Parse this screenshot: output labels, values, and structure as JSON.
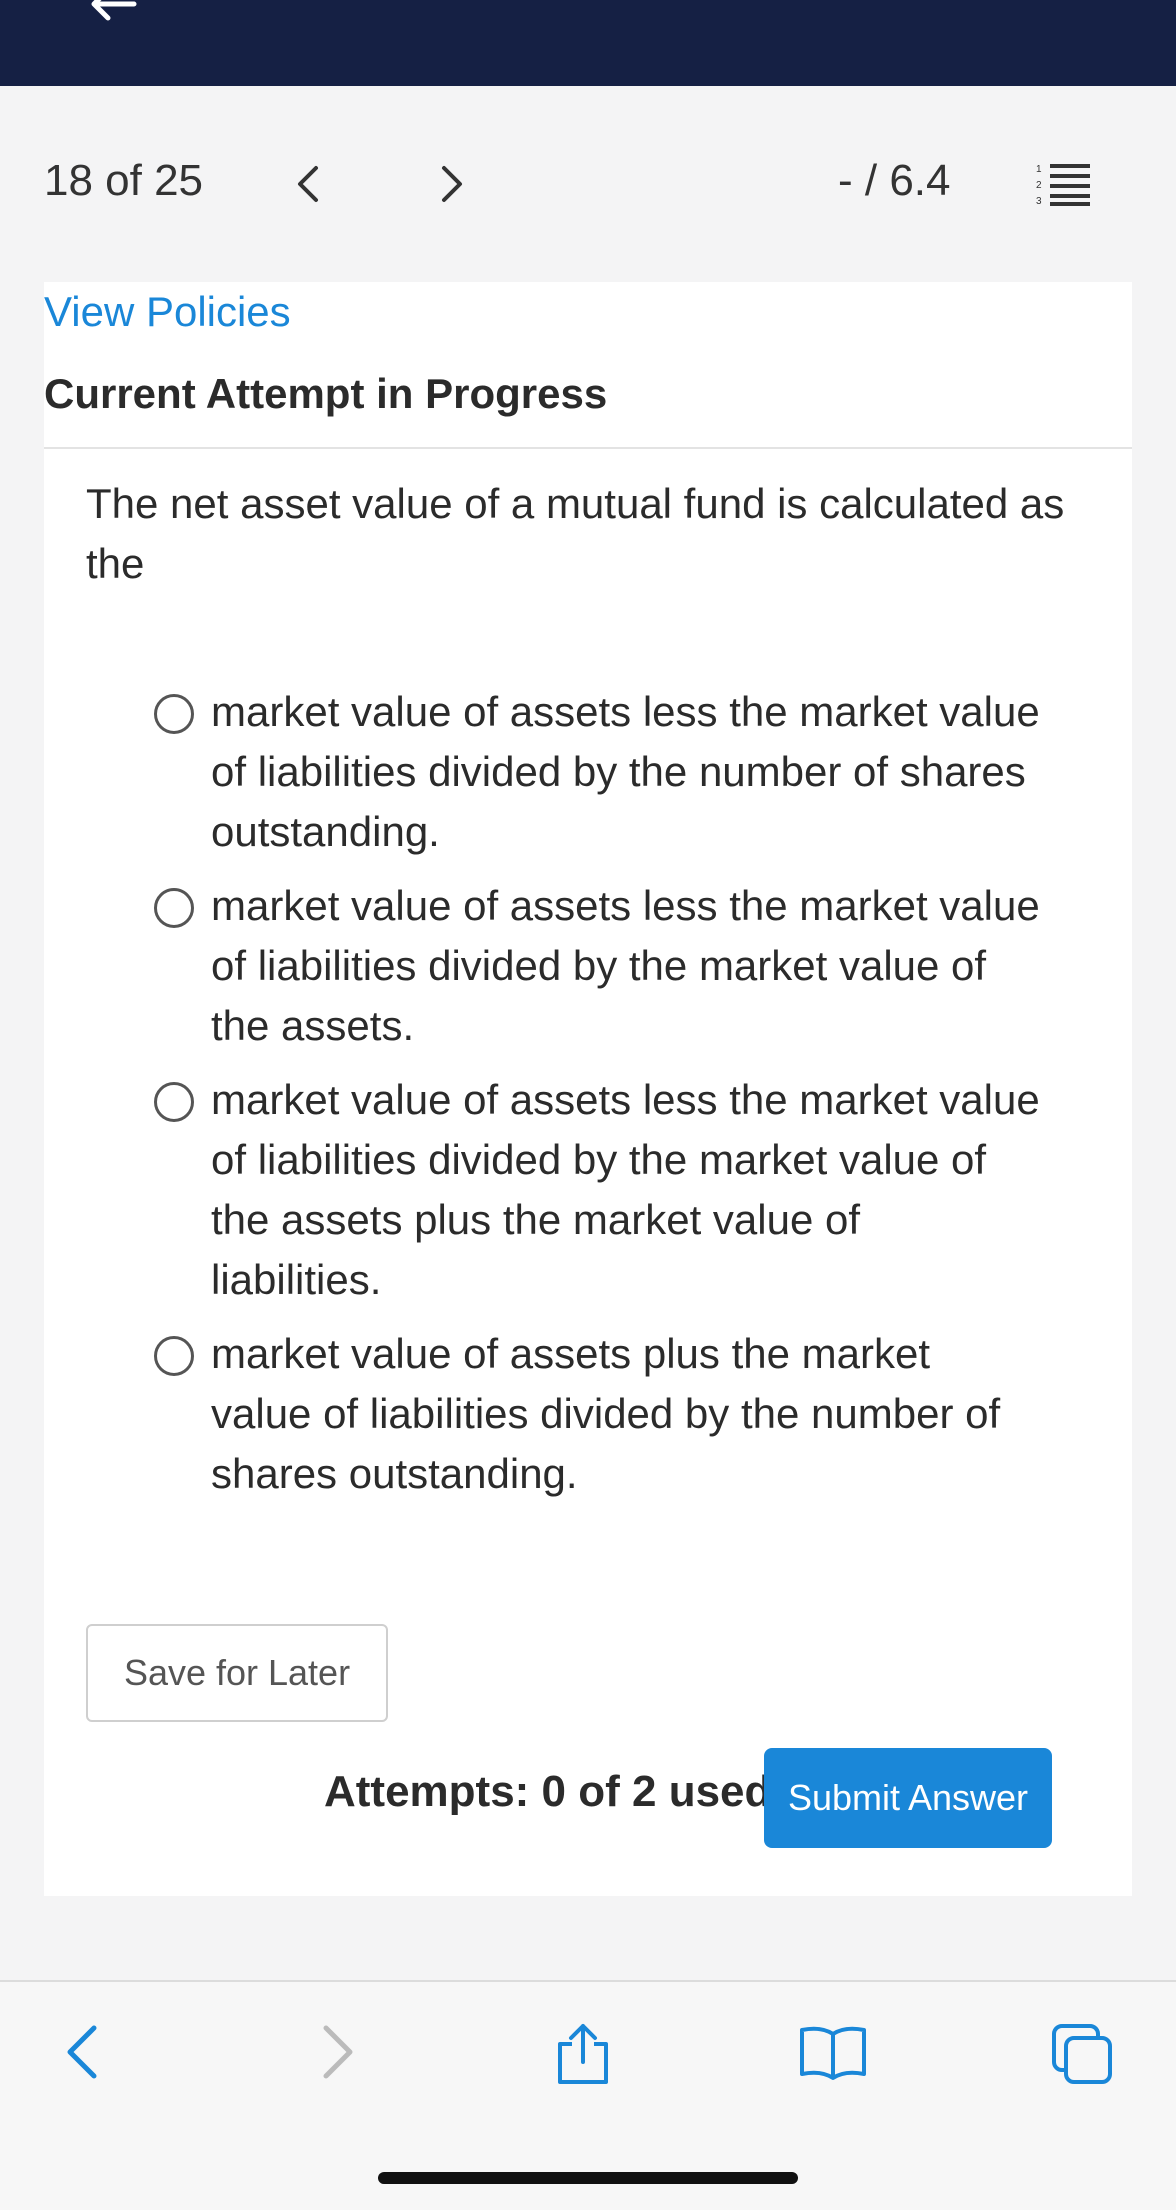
{
  "header": {
    "back_icon": "arrow-left-icon"
  },
  "nav": {
    "counter": "18 of 25",
    "prev_icon": "chevron-left-icon",
    "next_icon": "chevron-right-icon",
    "score": "- / 6.4",
    "list_icon": "numbered-list-icon"
  },
  "card": {
    "view_policies": "View Policies",
    "status_title": "Current Attempt in Progress",
    "question": "The net asset value of a mutual fund is calculated as the",
    "options": [
      {
        "label": "market value of assets less the market value of liabilities divided by the number of shares outstanding.",
        "selected": false
      },
      {
        "label": "market value of assets less the market value of liabilities divided by the market value of the assets.",
        "selected": false
      },
      {
        "label": "market value of assets less the market value of liabilities divided by the market value of the assets plus the market value of liabilities.",
        "selected": false
      },
      {
        "label": "market value of assets plus the market value of liabilities divided by the number of shares outstanding.",
        "selected": false
      }
    ],
    "save_label": "Save for Later",
    "attempts": "Attempts: 0 of 2 used",
    "submit_label": "Submit Answer"
  },
  "browser_bar": {
    "icons": [
      "back-icon",
      "forward-icon",
      "share-icon",
      "bookmarks-icon",
      "tabs-icon"
    ]
  },
  "colors": {
    "header_bg": "#152044",
    "accent": "#1a87d8",
    "page_bg": "#f4f4f5"
  }
}
